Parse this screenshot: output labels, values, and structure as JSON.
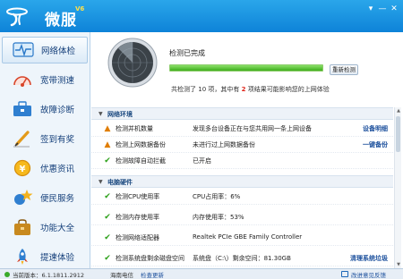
{
  "window": {
    "title": "微服",
    "version_badge": "V6",
    "controls": [
      "▾",
      "—",
      "✕"
    ]
  },
  "sidebar": {
    "items": [
      {
        "label": "网络体检",
        "icon": "heartbeat-monitor-icon",
        "active": true
      },
      {
        "label": "宽带测速",
        "icon": "speedometer-icon",
        "active": false
      },
      {
        "label": "故障诊断",
        "icon": "toolbox-icon",
        "active": false
      },
      {
        "label": "签到有奖",
        "icon": "pen-checkin-icon",
        "active": false
      },
      {
        "label": "优惠资讯",
        "icon": "coin-icon",
        "active": false
      },
      {
        "label": "便民服务",
        "icon": "star-service-icon",
        "active": false
      },
      {
        "label": "功能大全",
        "icon": "bag-icon",
        "active": false
      },
      {
        "label": "提速体验",
        "icon": "rocket-icon",
        "active": false
      }
    ]
  },
  "scan": {
    "status_title": "检测已完成",
    "progress": 1.0,
    "rescan_label": "重新检测",
    "summary": {
      "prefix": "共检测了",
      "total": "10",
      "middle": "项，其中有",
      "issues": "2",
      "suffix": "项结果可能影响您的上网体验"
    }
  },
  "sections": [
    {
      "title": "网络环境",
      "rows": [
        {
          "status": "warn",
          "name": "检测并机数量",
          "desc": "发现多台设备正在与您共用网一条上网设备",
          "action": "设备明细"
        },
        {
          "status": "warn",
          "name": "检测上网数据备份",
          "desc": "未进行过上网数据备份",
          "action": "一键备份"
        },
        {
          "status": "ok",
          "name": "检测故障自动拦截",
          "desc": "已开启",
          "action": ""
        }
      ]
    },
    {
      "title": "电脑硬件",
      "rows": [
        {
          "status": "ok",
          "name": "检测CPU使用率",
          "desc": "CPU占用率：6%",
          "action": ""
        },
        {
          "status": "ok",
          "name": "检测内存使用率",
          "desc": "内存使用率：53%",
          "action": ""
        },
        {
          "status": "ok",
          "name": "检测网络适配器",
          "desc": "Realtek PCIe GBE Family Controller",
          "action": ""
        },
        {
          "status": "ok",
          "name": "检测系统盘剩余磁盘空间",
          "desc": "系统盘（C:\\）剩余空间：81.30GB",
          "action": "清理系统垃圾"
        }
      ]
    }
  ],
  "statusbar": {
    "version_text": "当前版本：6.1.1811.2912",
    "isp": "海南电信",
    "check_update": "检查更新",
    "feedback": "改进意见反馈"
  },
  "colors": {
    "titlebar": "#1a93e0",
    "warn": "#e07d00",
    "ok": "#2da11a",
    "highlight": "#e0261a",
    "link": "#1b4f9c"
  }
}
